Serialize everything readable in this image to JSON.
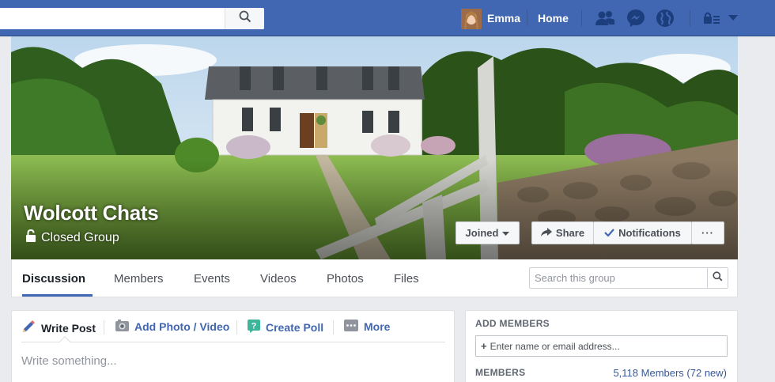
{
  "topbar": {
    "user_name": "Emma",
    "home_label": "Home"
  },
  "cover": {
    "group_name": "Wolcott Chats",
    "privacy": "Closed Group",
    "buttons": {
      "joined": "Joined",
      "share": "Share",
      "notifications": "Notifications",
      "more": "···"
    }
  },
  "tabs": [
    {
      "label": "Discussion"
    },
    {
      "label": "Members"
    },
    {
      "label": "Events"
    },
    {
      "label": "Videos"
    },
    {
      "label": "Photos"
    },
    {
      "label": "Files"
    }
  ],
  "group_search": {
    "placeholder": "Search this group"
  },
  "composer": {
    "tabs": [
      {
        "label": "Write Post"
      },
      {
        "label": "Add Photo / Video"
      },
      {
        "label": "Create Poll"
      },
      {
        "label": "More"
      }
    ],
    "placeholder": "Write something..."
  },
  "sidebar": {
    "add_members_heading": "ADD MEMBERS",
    "add_members_placeholder": "Enter name or email address...",
    "members_heading": "MEMBERS",
    "members_count": "5,118 Members (72 new)"
  },
  "colors": {
    "brand": "#4267b2",
    "link": "#365899"
  }
}
